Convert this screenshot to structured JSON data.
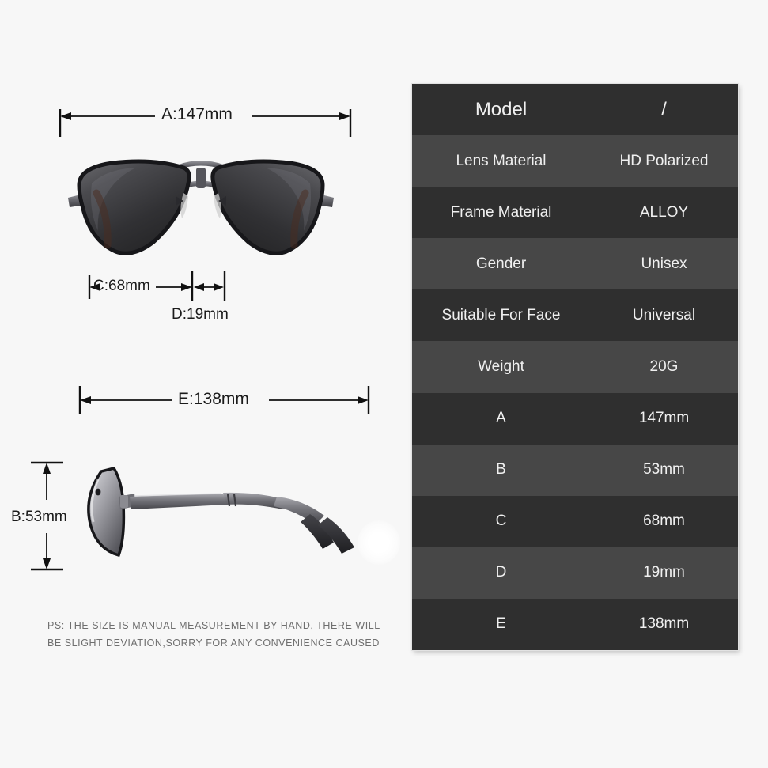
{
  "background_color": "#f7f7f7",
  "dimensions": {
    "a": {
      "label": "A:147mm"
    },
    "b": {
      "label": "B:53mm"
    },
    "c": {
      "label": "C:68mm"
    },
    "d": {
      "label": "D:19mm"
    },
    "e": {
      "label": "E:138mm"
    }
  },
  "note": {
    "line1": "PS: THE SIZE IS MANUAL MEASUREMENT BY HAND, THERE WILL",
    "line2": "BE SLIGHT DEVIATION,SORRY FOR ANY CONVENIENCE CAUSED"
  },
  "spec_table": {
    "colors": {
      "row_dark": "#2f2f2f",
      "row_light": "#474747",
      "text": "#f0f0f0"
    },
    "rows": [
      {
        "label": "Model",
        "value": "/"
      },
      {
        "label": "Lens Material",
        "value": "HD Polarized"
      },
      {
        "label": "Frame Material",
        "value": "ALLOY"
      },
      {
        "label": "Gender",
        "value": "Unisex"
      },
      {
        "label": "Suitable For Face",
        "value": "Universal"
      },
      {
        "label": "Weight",
        "value": "20G"
      },
      {
        "label": "A",
        "value": "147mm"
      },
      {
        "label": "B",
        "value": "53mm"
      },
      {
        "label": "C",
        "value": "68mm"
      },
      {
        "label": "D",
        "value": "19mm"
      },
      {
        "label": "E",
        "value": "138mm"
      }
    ]
  }
}
